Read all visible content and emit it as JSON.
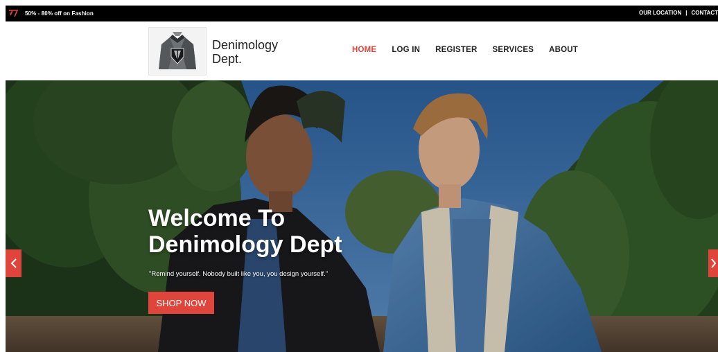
{
  "topbar": {
    "promo_text": "50% - 80% off on Fashion",
    "links": [
      "OUR LOCATION",
      "CONTACT"
    ],
    "separator": "|"
  },
  "header": {
    "brand_line1": "Denimology",
    "brand_line2": "Dept.",
    "logo_icon": "denim-jacket-logo-icon"
  },
  "nav": {
    "items": [
      "HOME",
      "LOG IN",
      "REGISTER",
      "SERVICES",
      "ABOUT"
    ],
    "active": "HOME"
  },
  "hero": {
    "title_line1": "Welcome To",
    "title_line2": "Denimology Dept",
    "quote": "\"Remind yourself. Nobody built like you, you design yourself.\"",
    "button_label": "SHOP NOW",
    "prev_icon": "chevron-left-icon",
    "next_icon": "chevron-right-icon"
  },
  "colors": {
    "accent": "#e0453b",
    "topbar_bg": "#000000",
    "text_dark": "#222222"
  }
}
